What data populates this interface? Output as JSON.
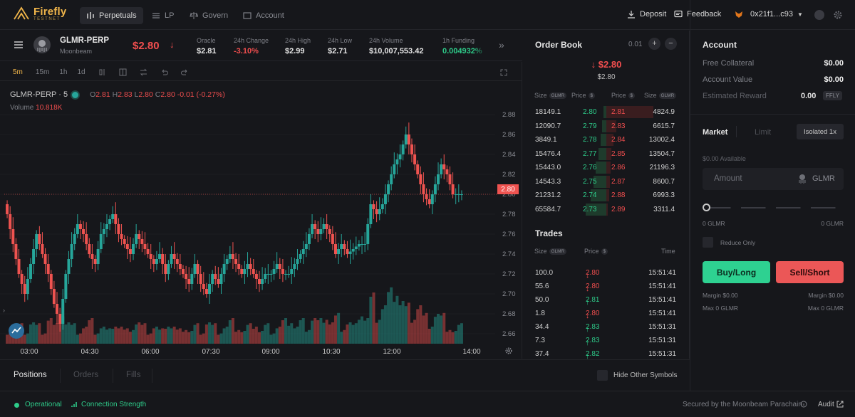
{
  "brand": {
    "name": "Firefly",
    "sub": "TESTNET"
  },
  "nav": [
    {
      "label": "Perpetuals"
    },
    {
      "label": "LP"
    },
    {
      "label": "Govern"
    },
    {
      "label": "Account"
    }
  ],
  "top_actions": {
    "deposit": "Deposit",
    "feedback": "Feedback",
    "wallet": "0x21f1...c93"
  },
  "market": {
    "symbol": "GLMR-PERP",
    "chain": "Moonbeam",
    "price": "$2.80",
    "stats": [
      {
        "label": "Oracle",
        "value": "$2.81"
      },
      {
        "label": "24h Change",
        "value": "-3.10%"
      },
      {
        "label": "24h High",
        "value": "$2.99"
      },
      {
        "label": "24h Low",
        "value": "$2.71"
      },
      {
        "label": "24h Volume",
        "value": "$10,007,553.42"
      },
      {
        "label": "1h Funding",
        "value": "0.004932%"
      }
    ]
  },
  "toolbar": {
    "timeframes": [
      "5m",
      "15m",
      "1h",
      "1d"
    ]
  },
  "chart": {
    "legend_symbol": "GLMR-PERP · 5",
    "ohlc": {
      "o": "2.81",
      "h": "2.83",
      "l": "2.80",
      "c": "2.80",
      "chg": "-0.01 (-0.27%)"
    },
    "volume_label": "Volume",
    "volume_value": "10.818K",
    "last_price_tag": "2.80",
    "y_ticks": [
      "2.88",
      "2.86",
      "2.84",
      "2.82",
      "2.80",
      "2.78",
      "2.76",
      "2.74",
      "2.72",
      "2.70",
      "2.68",
      "2.66"
    ],
    "x_ticks": [
      "03:00",
      "04:30",
      "06:00",
      "07:30",
      "09:00",
      "10:30",
      "12:00",
      "14:00"
    ],
    "colors": {
      "up": "#26a69a",
      "down": "#ef5350",
      "bg": "#16171b"
    }
  },
  "chart_data": {
    "type": "candlestick",
    "ylim": [
      2.65,
      2.89
    ],
    "close_series": [
      2.78,
      2.75,
      2.72,
      2.7,
      2.73,
      2.76,
      2.74,
      2.72,
      2.69,
      2.67,
      2.72,
      2.75,
      2.77,
      2.76,
      2.74,
      2.73,
      2.76,
      2.77,
      2.78,
      2.76,
      2.75,
      2.74,
      2.76,
      2.75,
      2.74,
      2.73,
      2.74,
      2.72,
      2.74,
      2.73,
      2.72,
      2.71,
      2.73,
      2.71,
      2.7,
      2.72,
      2.71,
      2.73,
      2.74,
      2.73,
      2.72,
      2.73,
      2.72,
      2.71,
      2.72,
      2.72,
      2.73,
      2.72,
      2.72,
      2.73,
      2.74,
      2.75,
      2.77,
      2.76,
      2.77,
      2.76,
      2.74,
      2.75,
      2.74,
      2.745,
      2.75,
      2.75,
      2.79,
      2.78,
      2.79,
      2.81,
      2.83,
      2.84,
      2.86,
      2.84,
      2.82,
      2.8,
      2.79,
      2.81,
      2.83,
      2.82,
      2.8,
      2.8
    ],
    "volume_series": [
      3,
      2,
      4,
      3,
      5,
      4,
      3,
      6,
      4,
      8,
      5,
      4,
      3,
      4,
      5,
      3,
      4,
      3,
      5,
      4,
      3,
      4,
      5,
      4,
      3,
      4,
      3,
      5,
      4,
      3,
      4,
      3,
      4,
      3,
      5,
      4,
      3,
      4,
      5,
      4,
      3,
      4,
      5,
      3,
      4,
      3,
      4,
      5,
      6,
      4,
      5,
      4,
      6,
      5,
      7,
      5,
      6,
      4,
      5,
      4,
      8,
      6,
      10,
      7,
      9,
      11,
      14,
      10,
      8,
      7,
      9,
      6,
      5,
      7,
      6,
      4,
      3,
      4
    ]
  },
  "orderbook": {
    "title": "Order Book",
    "tick": "0.01",
    "mid_price": "$2.80",
    "mid_sub": "$2.80",
    "headers": {
      "size": "Size",
      "price": "Price",
      "unit": "GLMR",
      "usd": "$"
    },
    "rows": [
      {
        "bsize": "18149.1",
        "bprice": "2.80",
        "aprice": "2.81",
        "asize": "4824.9",
        "bd": 0.12,
        "ad": 0.55
      },
      {
        "bsize": "12090.7",
        "bprice": "2.79",
        "aprice": "2.83",
        "asize": "6615.7",
        "bd": 0.2,
        "ad": 0.12
      },
      {
        "bsize": "3849.1",
        "bprice": "2.78",
        "aprice": "2.84",
        "asize": "13002.4",
        "bd": 0.25,
        "ad": 0.08
      },
      {
        "bsize": "15476.4",
        "bprice": "2.77",
        "aprice": "2.85",
        "asize": "13504.7",
        "bd": 0.36,
        "ad": 0.06
      },
      {
        "bsize": "15443.0",
        "bprice": "2.76",
        "aprice": "2.86",
        "asize": "21196.3",
        "bd": 0.48,
        "ad": 0.05
      },
      {
        "bsize": "14543.3",
        "bprice": "2.75",
        "aprice": "2.87",
        "asize": "8600.7",
        "bd": 0.58,
        "ad": 0.04
      },
      {
        "bsize": "21231.2",
        "bprice": "2.74",
        "aprice": "2.88",
        "asize": "6993.3",
        "bd": 0.72,
        "ad": 0.03
      },
      {
        "bsize": "65584.7",
        "bprice": "2.73",
        "aprice": "2.89",
        "asize": "3311.4",
        "bd": 0.95,
        "ad": 0.02
      }
    ]
  },
  "trades": {
    "title": "Trades",
    "headers": {
      "size": "Size",
      "price": "Price",
      "time": "Time"
    },
    "rows": [
      {
        "size": "100.0",
        "price": "2.80",
        "dir": "down",
        "time": "15:51:41"
      },
      {
        "size": "55.6",
        "price": "2.80",
        "dir": "down",
        "time": "15:51:41"
      },
      {
        "size": "50.0",
        "price": "2.81",
        "dir": "up",
        "time": "15:51:41"
      },
      {
        "size": "1.8",
        "price": "2.80",
        "dir": "down",
        "time": "15:51:41"
      },
      {
        "size": "34.4",
        "price": "2.83",
        "dir": "up",
        "time": "15:51:31"
      },
      {
        "size": "7.3",
        "price": "2.83",
        "dir": "up",
        "time": "15:51:31"
      },
      {
        "size": "37.4",
        "price": "2.82",
        "dir": "up",
        "time": "15:51:31"
      }
    ]
  },
  "account": {
    "title": "Account",
    "free_collateral_label": "Free Collateral",
    "free_collateral": "$0.00",
    "account_value_label": "Account Value",
    "account_value": "$0.00",
    "reward_label": "Estimated Reward",
    "reward": "0.00",
    "reward_unit": "FFLY"
  },
  "order_form": {
    "tab_market": "Market",
    "tab_limit": "Limit",
    "margin_mode": "Isolated 1x",
    "available": "$0.00 Available",
    "amount_placeholder": "Amount",
    "amount_unit": "GLMR",
    "slider_min": "0 GLMR",
    "slider_max": "0 GLMR",
    "slider_value": 0,
    "reduce_only": "Reduce Only",
    "buy": "Buy/Long",
    "sell": "Sell/Short",
    "margin_left": "Margin $0.00",
    "margin_right": "Margin $0.00",
    "max_left": "Max 0 GLMR",
    "max_right": "Max 0 GLMR"
  },
  "bottom_tabs": {
    "positions": "Positions",
    "orders": "Orders",
    "fills": "Fills",
    "hide_other": "Hide Other Symbols"
  },
  "footer": {
    "operational": "Operational",
    "connection": "Connection Strength",
    "secured": "Secured by the Moonbeam Parachain",
    "audit": "Audit"
  }
}
